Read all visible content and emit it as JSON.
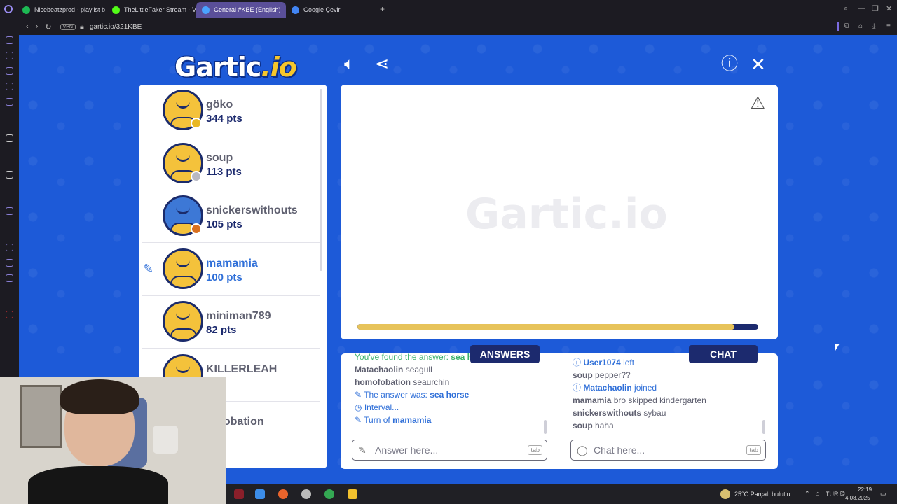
{
  "browser": {
    "tabs": [
      {
        "label": "Nicebeatzprod - playlist b",
        "color": "#1db954"
      },
      {
        "label": "TheLittleFaker Stream - V",
        "color": "#53fc18"
      },
      {
        "label": "General #KBE (English)",
        "color": "#4aa3ff",
        "active": true
      },
      {
        "label": "Google Çeviri",
        "color": "#4285f4"
      }
    ],
    "new_tab": "+",
    "vpn": "VPN",
    "url": "gartic.io/321KBE"
  },
  "game": {
    "logo_main": "Gartic",
    "logo_suffix": ".io",
    "watermark": "Gartic.io",
    "players": [
      {
        "name": "göko",
        "points": "344 pts",
        "badge": "#e9b824",
        "avatar": "yellow"
      },
      {
        "name": "soup",
        "points": "113 pts",
        "badge": "#b9b9c2",
        "avatar": "yellow"
      },
      {
        "name": "snickerswithouts",
        "points": "105 pts",
        "badge": "#d9701f",
        "avatar": "blue"
      },
      {
        "name": "mamamia",
        "points": "100 pts",
        "drawing": true,
        "avatar": "yellow"
      },
      {
        "name": "miniman789",
        "points": "82 pts",
        "avatar": "yellow"
      },
      {
        "name": "KILLERLEAH",
        "points": "pts",
        "avatar": "yellow"
      },
      {
        "name": "nofobation",
        "points": "pts",
        "avatar": "yellow"
      }
    ],
    "timer_fraction": 0.94,
    "answers_label": "ANSWERS",
    "chat_label": "CHAT",
    "answers_feed": [
      {
        "type": "ok",
        "text": "You've found the answer: ",
        "strong": "sea horse"
      },
      {
        "type": "msg",
        "user": "Matachaolin",
        "text": "seagull"
      },
      {
        "type": "msg",
        "user": "homofobation",
        "text": "seaurchin"
      },
      {
        "type": "sys",
        "icon": "pencil-icon",
        "text": "The answer was: ",
        "strong": "sea horse"
      },
      {
        "type": "sys",
        "icon": "clock-icon",
        "text": "Interval..."
      },
      {
        "type": "sys",
        "icon": "pencil-icon",
        "text": "Turn of ",
        "strong": "mamamia"
      }
    ],
    "chat_feed": [
      {
        "type": "sys",
        "icon": "info-icon",
        "strong": "User1074",
        "text": " left"
      },
      {
        "type": "msg",
        "user": "soup",
        "text": "pepper??"
      },
      {
        "type": "sys",
        "icon": "info-icon",
        "strong": "Matachaolin",
        "text": " joined"
      },
      {
        "type": "msg",
        "user": "mamamia",
        "text": "bro skipped kindergarten"
      },
      {
        "type": "msg",
        "user": "snickerswithouts",
        "text": "sybau"
      },
      {
        "type": "msg",
        "user": "soup",
        "text": "haha"
      }
    ],
    "answer_placeholder": "Answer here...",
    "chat_placeholder": "Chat here...",
    "tab_key": "tab"
  },
  "taskbar": {
    "weather": "25°C  Parçalı bulutlu",
    "lang": "TUR",
    "time": "22:19",
    "date": "4.08.2025"
  }
}
